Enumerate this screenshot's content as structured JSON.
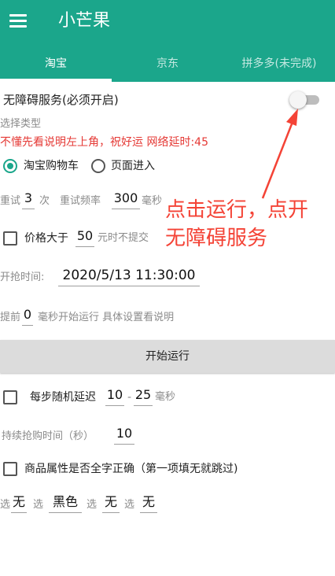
{
  "app": {
    "title": "小芒果"
  },
  "tabs": [
    {
      "label": "淘宝",
      "active": true
    },
    {
      "label": "京东",
      "active": false
    },
    {
      "label": "拼多多(未完成)",
      "active": false
    }
  ],
  "accessibility": {
    "label": "无障碍服务(必须开启)",
    "enabled": false
  },
  "type_select": {
    "label": "选择类型",
    "warning": "不懂先看说明左上角，祝好运 网络延时:45",
    "options": [
      {
        "label": "淘宝购物车",
        "selected": true
      },
      {
        "label": "页面进入",
        "selected": false
      }
    ]
  },
  "retry": {
    "prefix": "重试",
    "count": "3",
    "count_unit": "次",
    "freq_label": "重试频率",
    "freq": "300",
    "freq_unit": "毫秒"
  },
  "price": {
    "label": "价格大于",
    "value": "50",
    "suffix": "元时不提交",
    "checked": false
  },
  "start_time": {
    "label": "开抢时间:",
    "value": "2020/5/13 11:30:00"
  },
  "advance": {
    "prefix": "提前",
    "value": "0",
    "suffix": "毫秒开始运行 具体设置看说明"
  },
  "run_button": {
    "label": "开始运行"
  },
  "random_delay": {
    "label": "每步随机延迟",
    "min": "10",
    "separator": "-",
    "max": "25",
    "unit": "毫秒",
    "checked": false
  },
  "duration": {
    "label": "持续抢购时间（秒）",
    "value": "10"
  },
  "exact_match": {
    "label": "商品属性是否全字正确（第一项填无就跳过)",
    "checked": false
  },
  "attributes": [
    {
      "prefix": "选",
      "value": "无"
    },
    {
      "prefix": "选",
      "value": "黑色"
    },
    {
      "prefix": "选",
      "value": "无"
    },
    {
      "prefix": "选",
      "value": "无"
    }
  ],
  "annotation": {
    "line1": "点击运行，点开",
    "line2": "无障碍服务"
  },
  "colors": {
    "primary": "#1ba68b",
    "warning": "#e53935",
    "annotation": "#f44336"
  }
}
